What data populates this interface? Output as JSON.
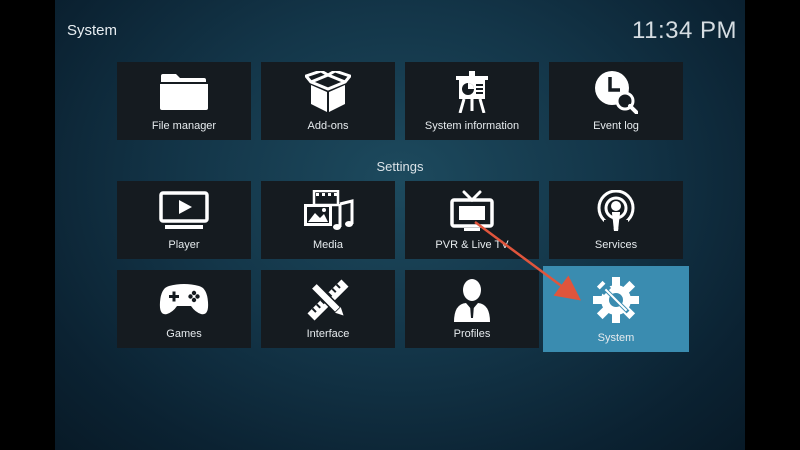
{
  "header": {
    "title": "System",
    "clock": "11:34 PM"
  },
  "top_row": [
    {
      "label": "File manager",
      "icon": "folder-icon"
    },
    {
      "label": "Add-ons",
      "icon": "open-box-icon"
    },
    {
      "label": "System information",
      "icon": "presentation-chart-icon"
    },
    {
      "label": "Event log",
      "icon": "clock-search-icon"
    }
  ],
  "settings": {
    "section_label": "Settings",
    "rows": [
      [
        {
          "label": "Player",
          "icon": "play-monitor-icon"
        },
        {
          "label": "Media",
          "icon": "media-images-music-icon"
        },
        {
          "label": "PVR & Live TV",
          "icon": "tv-antenna-icon"
        },
        {
          "label": "Services",
          "icon": "podcast-broadcast-icon"
        }
      ],
      [
        {
          "label": "Games",
          "icon": "gamepad-icon"
        },
        {
          "label": "Interface",
          "icon": "ruler-pencil-icon"
        },
        {
          "label": "Profiles",
          "icon": "person-icon"
        },
        {
          "label": "System",
          "icon": "gear-wrench-icon",
          "focused": true
        }
      ]
    ]
  },
  "annotation": {
    "arrow_color": "#e0553c"
  },
  "colors": {
    "tile_bg": "#151b20",
    "focus_bg": "#3a8cb0",
    "icon_fill": "#ffffff"
  }
}
